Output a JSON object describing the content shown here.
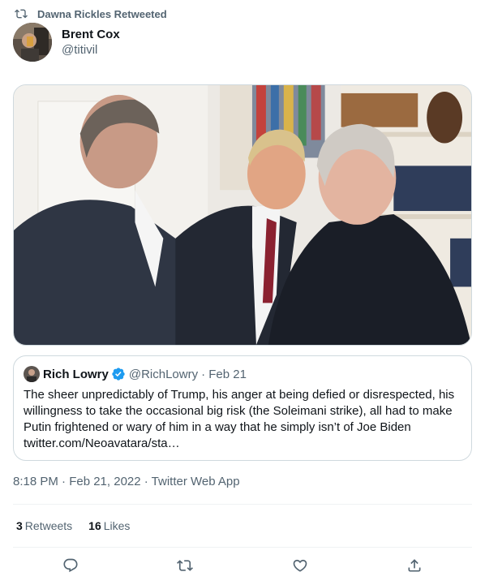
{
  "retweet_header": {
    "text": "Dawna Rickles Retweeted",
    "icon": "retweet-icon"
  },
  "author": {
    "name": "Brent Cox",
    "handle": "@titivil"
  },
  "media": {
    "description_icon": "photo"
  },
  "quote": {
    "name": "Rich Lowry",
    "handle": "@RichLowry",
    "date": "· Feb 21",
    "verified_color": "#1d9bf0",
    "text": "The sheer unpredictably of Trump, his anger at being defied or disrespected, his willingness to take the occasional big risk (the Soleimani strike), all had to make Putin frightened or wary of him in a way that he simply isn’t of Joe Biden twitter.com/Neoavatara/sta…"
  },
  "timestamp": "8:18 PM · Feb 21, 2022 · Twitter Web App",
  "stats": {
    "retweets_count": "3",
    "retweets_label": "Retweets",
    "likes_count": "16",
    "likes_label": "Likes"
  },
  "actions": [
    "reply-icon",
    "retweet-icon",
    "like-icon",
    "share-icon"
  ],
  "colors": {
    "secondary_text": "#536471",
    "primary_text": "#0f1419",
    "border": "#cfd9de",
    "divider": "#eff3f4",
    "verified": "#1d9bf0"
  }
}
